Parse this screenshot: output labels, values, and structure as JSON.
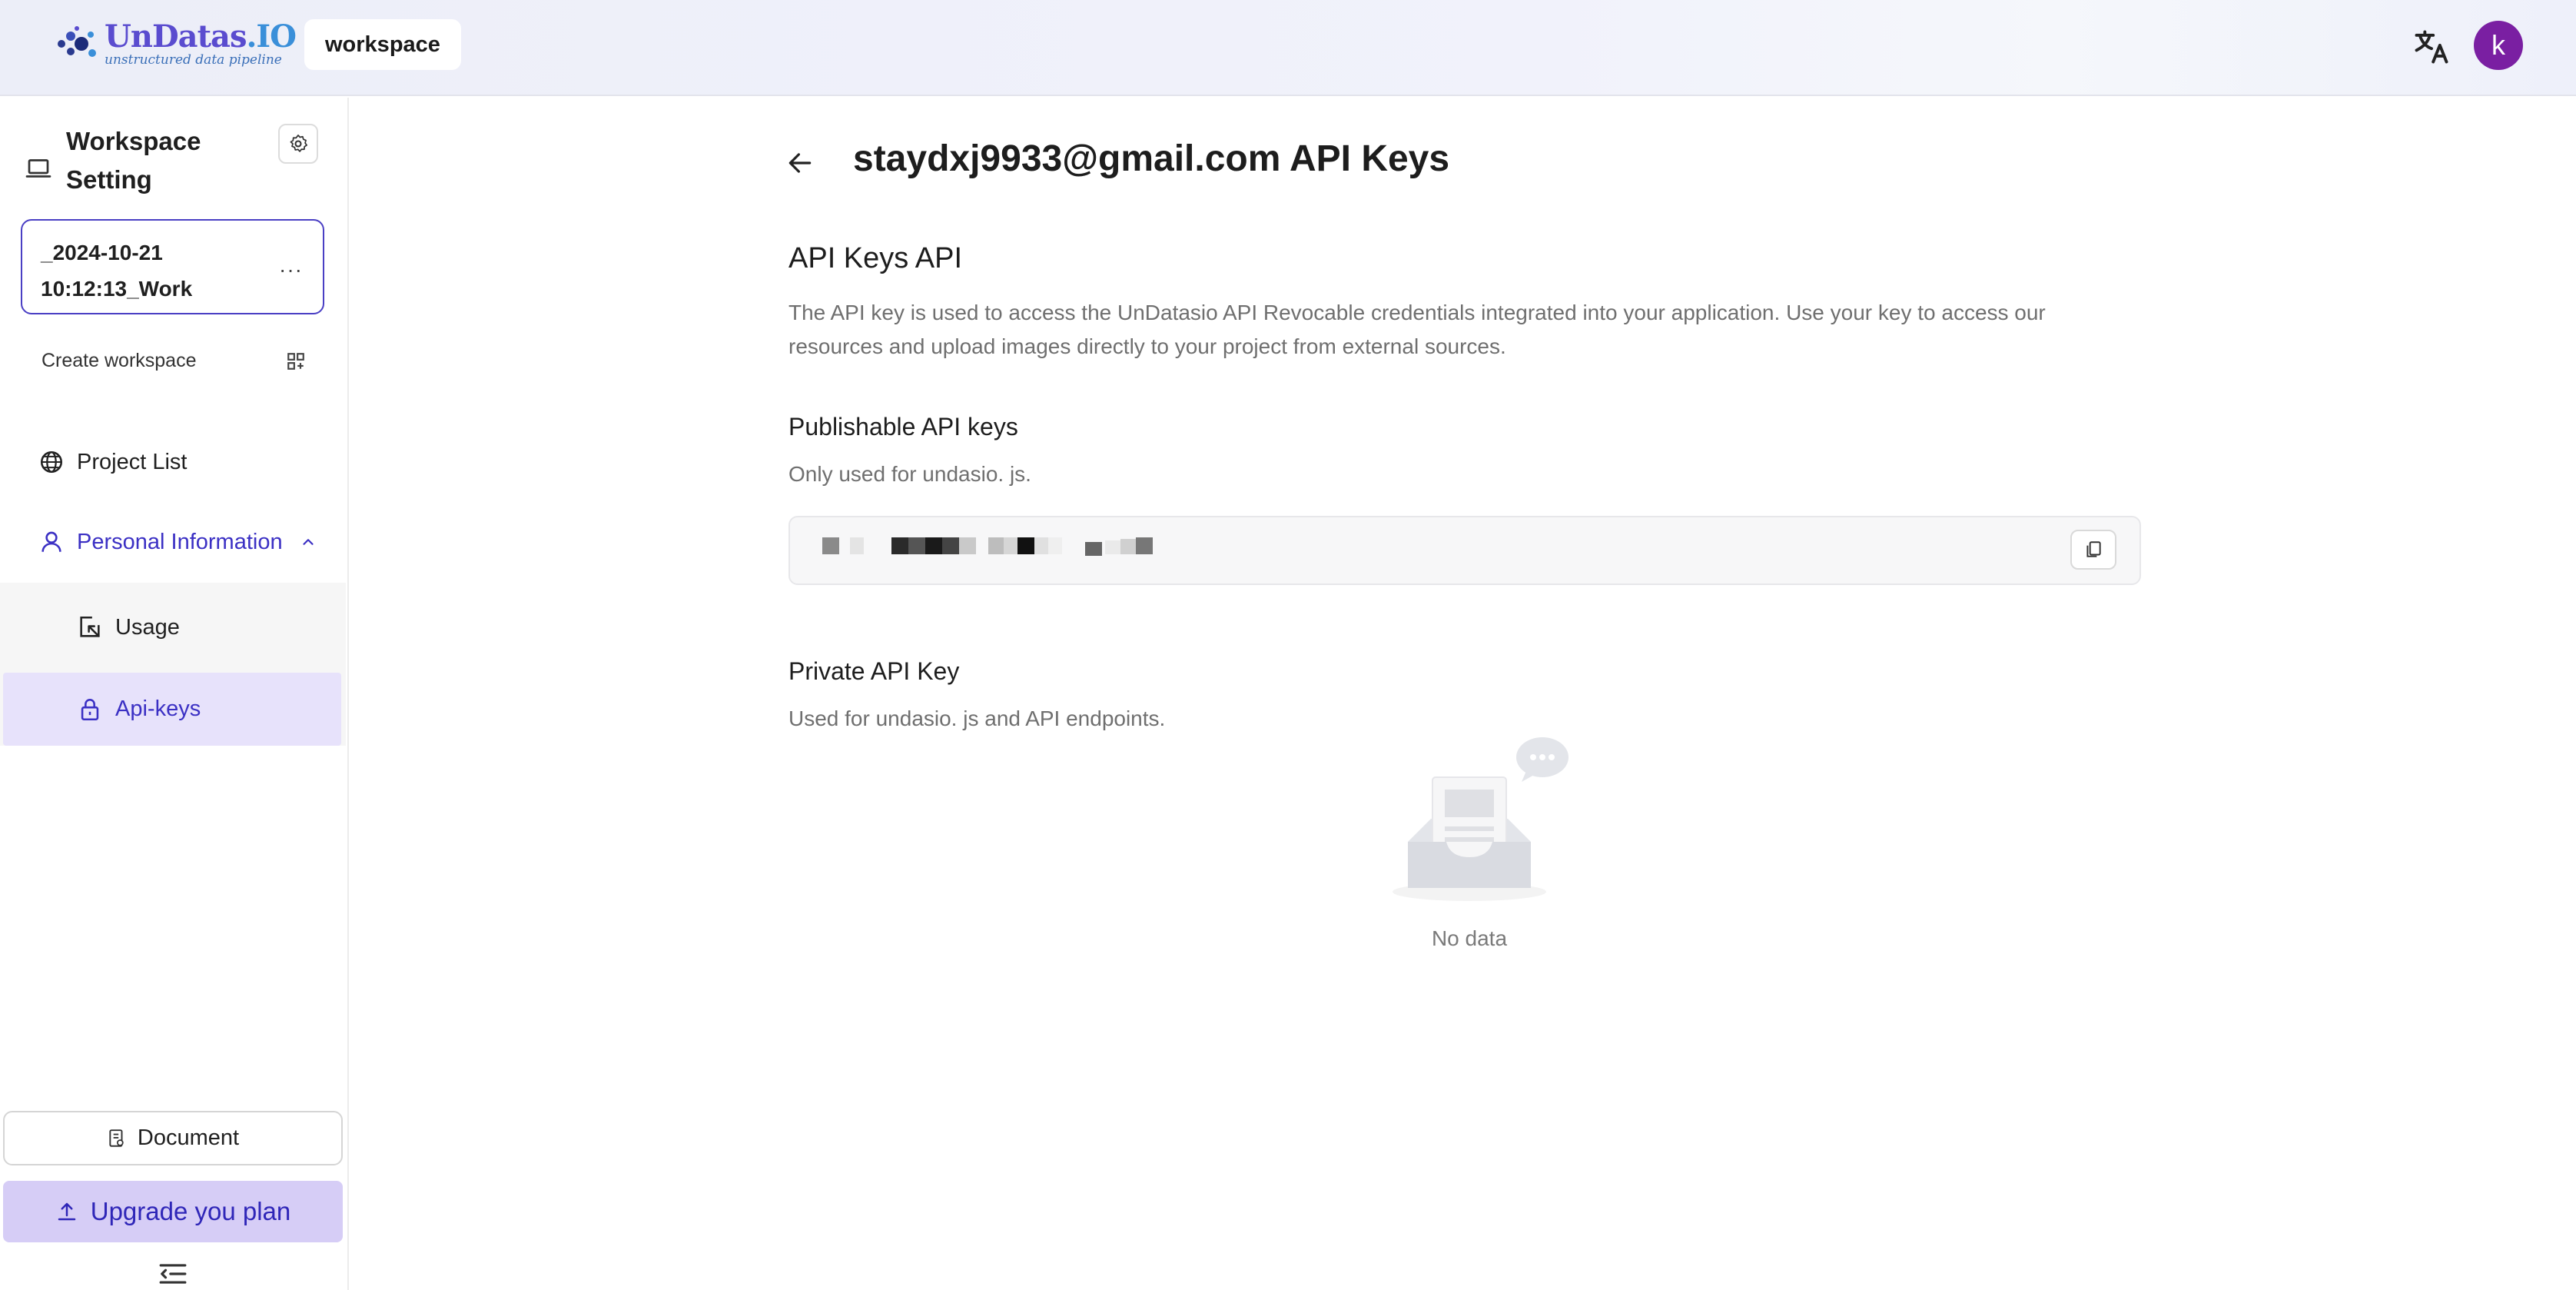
{
  "header": {
    "logo_name_main": "UnDatas",
    "logo_name_suffix": ".IO",
    "logo_tagline": "unstructured data pipeline",
    "workspace_pill": "workspace",
    "avatar_initial": "k",
    "translate_icon": "translate-icon"
  },
  "sidebar": {
    "workspace_setting_title": "Workspace Setting",
    "workspace_card_line1": "_2024-10-21",
    "workspace_card_line2": "10:12:13_Work",
    "workspace_card_more": "···",
    "create_workspace": "Create workspace",
    "nav": {
      "project_list": "Project List",
      "personal_information": "Personal Information",
      "usage": "Usage",
      "api_keys": "Api-keys"
    },
    "document_button": "Document",
    "upgrade_button": "Upgrade you plan"
  },
  "main": {
    "page_title": "staydxj9933@gmail.com API Keys",
    "section_title": "API Keys API",
    "section_desc": "The API key is used to access the UnDatasio API Revocable credentials integrated into your application. Use your key to access our resources and upload images directly to your project from external sources.",
    "publishable_title": "Publishable API keys",
    "publishable_desc": "Only used for undasio. js.",
    "private_title": "Private API Key",
    "private_desc": "Used for undasio. js and API endpoints.",
    "empty_text": "No data"
  },
  "colors": {
    "accent": "#3b30c4",
    "active_bg": "#e7e2fb",
    "upgrade_bg": "#d6cdf6",
    "avatar_bg": "#7a1fa2"
  }
}
